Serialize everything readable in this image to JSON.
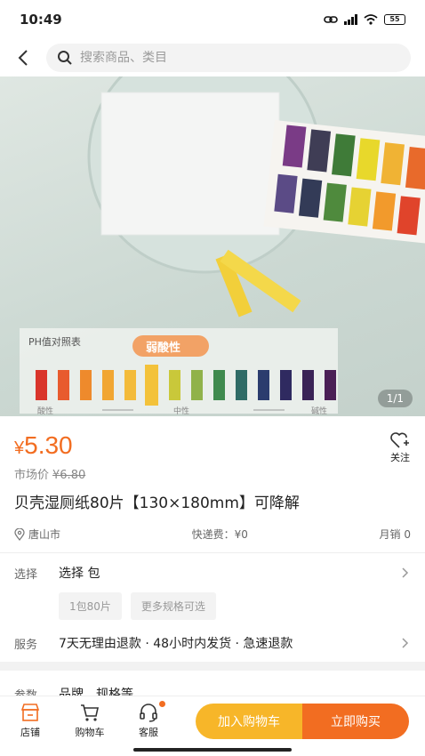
{
  "status": {
    "time": "10:49",
    "battery": "55"
  },
  "search": {
    "placeholder": "搜索商品、类目"
  },
  "gallery": {
    "pager": "1/1",
    "chart_title": "PH值对照表",
    "highlight": "弱酸性",
    "scale_left": "酸性",
    "scale_mid": "中性",
    "scale_right": "碱性"
  },
  "product": {
    "price_symbol": "¥",
    "price": "5.30",
    "market_label": "市场价",
    "market_price": "¥6.80",
    "follow_label": "关注",
    "title": "贝壳湿厕纸80片【130×180mm】可降解",
    "location": "唐山市",
    "shipping": "快递费：¥0",
    "monthly_sales": "月销 0"
  },
  "options": {
    "select_label": "选择",
    "select_value": "选择 包",
    "chips": [
      "1包80片",
      "更多规格可选"
    ]
  },
  "service": {
    "label": "服务",
    "value": "7天无理由退款 · 48小时内发货 · 急速退款"
  },
  "params": {
    "label": "参数",
    "value": "品牌、规格等"
  },
  "tabbar": {
    "shop": "店铺",
    "cart": "购物车",
    "service": "客服",
    "add_cart": "加入购物车",
    "buy_now": "立即购买"
  },
  "colors": {
    "accent": "#f26d21",
    "cart_btn": "#f7b629"
  }
}
